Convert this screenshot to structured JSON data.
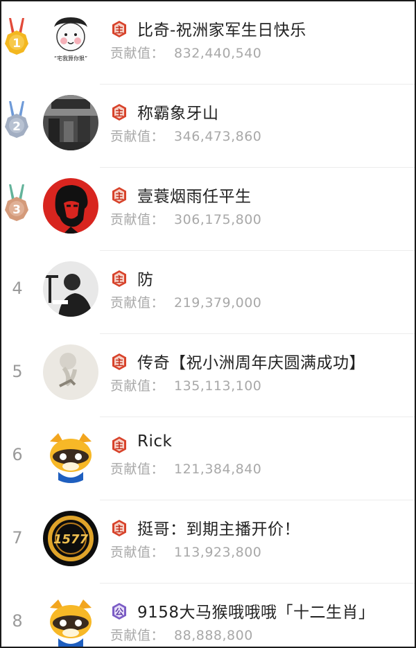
{
  "contribution_label": "贡献值：",
  "rows": [
    {
      "rank": "1",
      "name": "比奇-祝洲家军生日快乐",
      "value": "832,440,540",
      "badge": "主",
      "avatar_caption": "“宅我算你狠”"
    },
    {
      "rank": "2",
      "name": "称霸象牙山",
      "value": "346,473,860",
      "badge": "主"
    },
    {
      "rank": "3",
      "name": "壹蓑烟雨任平生",
      "value": "306,175,800",
      "badge": "主"
    },
    {
      "rank": "4",
      "name": "防",
      "value": "219,379,000",
      "badge": "主"
    },
    {
      "rank": "5",
      "name": "传奇【祝小洲周年庆圆满成功】",
      "value": "135,113,100",
      "badge": "主"
    },
    {
      "rank": "6",
      "name": "Rick",
      "value": "121,384,840",
      "badge": "主"
    },
    {
      "rank": "7",
      "name": "挺哥：到期主播开价！",
      "value": "113,923,800",
      "badge": "主",
      "avatar_text": "1577"
    },
    {
      "rank": "8",
      "name": "9158大马猴哦哦哦「十二生肖」",
      "value": "88,888,800",
      "badge": "公"
    }
  ],
  "colors": {
    "gold": "#f3b71f",
    "silver": "#a2aec2",
    "bronze": "#d49a7a",
    "ribbon_gold": "#e24a3a",
    "ribbon_silver": "#6e9ad8",
    "ribbon_bronze": "#63b39a",
    "badge_red": "#d8432b",
    "badge_purple": "#7b5cc6"
  }
}
